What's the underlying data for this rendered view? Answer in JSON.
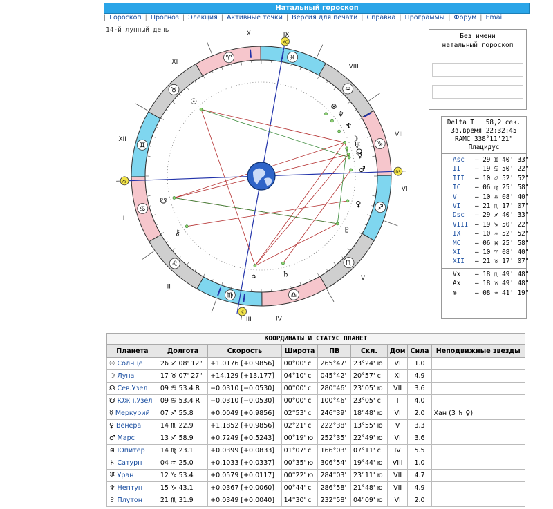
{
  "page": {
    "title": "Натальный гороскоп",
    "lunar_day": "14-й лунный день"
  },
  "menu": [
    "Гороскоп",
    "Прогноз",
    "Элекция",
    "Активные точки",
    "Версия для печати",
    "Справка",
    "Программы",
    "Форум",
    "Email"
  ],
  "wheel": {
    "house_numerals": [
      "I",
      "II",
      "III",
      "IV",
      "V",
      "VI",
      "VII",
      "VIII",
      "IX",
      "X",
      "XI",
      "XII"
    ],
    "sign_glyphs": [
      "♊",
      "♋",
      "♌",
      "♍",
      "♎",
      "♏",
      "♐",
      "♑",
      "♒",
      "♓",
      "♈",
      "♉"
    ],
    "badges": [
      "AS",
      "DS",
      "MC",
      "IC"
    ],
    "planet_glyphs": [
      "☉",
      "☽",
      "☊",
      "☋",
      "☿",
      "♀",
      "♂",
      "♃",
      "♄",
      "♅",
      "♆",
      "♇",
      "⊗",
      "⚷",
      "♆"
    ],
    "center": "globe"
  },
  "info": {
    "name": "Без имени",
    "subtitle": "натальный гороскоп"
  },
  "positions": {
    "delta_t_label": "Delta T",
    "delta_t": "58,2 сек.",
    "star_time_label": "Зв.время",
    "star_time": "22:32:45",
    "ramc": "RAMC 338°11'21\"",
    "system": "Плацидус",
    "cusps": [
      {
        "name": "Asc",
        "value": "29 ♊ 40' 33\""
      },
      {
        "name": "II",
        "value": "19 ♋ 50' 22\""
      },
      {
        "name": "III",
        "value": "10 ♌ 52' 52\""
      },
      {
        "name": "IC",
        "value": "06 ♍ 25' 58\""
      },
      {
        "name": "V",
        "value": "10 ♎ 08' 40\""
      },
      {
        "name": "VI",
        "value": "21 ♏ 17' 07\""
      },
      {
        "name": "Dsc",
        "value": "29 ♐ 40' 33\""
      },
      {
        "name": "VIII",
        "value": "19 ♑ 50' 22\""
      },
      {
        "name": "IX",
        "value": "10 ♒ 52' 52\""
      },
      {
        "name": "MC",
        "value": "06 ♓ 25' 58\""
      },
      {
        "name": "XI",
        "value": "10 ♈ 08' 40\""
      },
      {
        "name": "XII",
        "value": "21 ♉ 17' 07\""
      }
    ],
    "points": [
      {
        "name": "Vx",
        "value": "18 ♏ 49' 48\""
      },
      {
        "name": "Ax",
        "value": "18 ♉ 49' 48\""
      },
      {
        "name": "⊗",
        "value": "08 ♒ 41' 19\""
      }
    ]
  },
  "table": {
    "title": "КООРДИНАТЫ И СТАТУС ПЛАНЕТ",
    "headers": [
      "Планета",
      "Долгота",
      "Скорость",
      "Широта",
      "ПВ",
      "Скл.",
      "Дом",
      "Сила",
      "Неподвижные звезды"
    ],
    "rows": [
      {
        "glyph": "☉",
        "name": "Солнце",
        "lon": "26 ♐ 08' 12\"",
        "speed": "+1.0176",
        "speed2": "[+0.9856]",
        "lat": "00°00' с",
        "ra": "265°47'",
        "dec": "23°24' ю",
        "house": "VI",
        "power": "1.0",
        "stars": ""
      },
      {
        "glyph": "☽",
        "name": "Луна",
        "lon": "17 ♉ 07' 27\"",
        "speed": "+14.129",
        "speed2": "[+13.177]",
        "lat": "04°10' с",
        "ra": "045°42'",
        "dec": "20°57' с",
        "house": "XI",
        "power": "4.9",
        "stars": ""
      },
      {
        "glyph": "☊",
        "name": "Сев.Узел",
        "lon": "09 ♋ 53.4 R",
        "speed": "−0.0310",
        "speed2": "[−0.0530]",
        "lat": "00°00' с",
        "ra": "280°46'",
        "dec": "23°05' ю",
        "house": "VII",
        "power": "3.6",
        "stars": ""
      },
      {
        "glyph": "☋",
        "name": "Южн.Узел",
        "lon": "09 ♋ 53.4 R",
        "speed": "−0.0310",
        "speed2": "[−0.0530]",
        "lat": "00°00' с",
        "ra": "100°46'",
        "dec": "23°05' с",
        "house": "I",
        "power": "4.0",
        "stars": ""
      },
      {
        "glyph": "☿",
        "name": "Меркурий",
        "lon": "07 ♐ 55.8",
        "speed": "+0.0049",
        "speed2": "[+0.9856]",
        "lat": "02°53' с",
        "ra": "246°39'",
        "dec": "18°48' ю",
        "house": "VI",
        "power": "2.0",
        "stars": "Хан (3 ♄ ♀)"
      },
      {
        "glyph": "♀",
        "name": "Венера",
        "lon": "14 ♏ 22.9",
        "speed": "+1.1852",
        "speed2": "[+0.9856]",
        "lat": "02°21' с",
        "ra": "222°38'",
        "dec": "13°55' ю",
        "house": "V",
        "power": "3.3",
        "stars": ""
      },
      {
        "glyph": "♂",
        "name": "Марс",
        "lon": "13 ♐ 58.9",
        "speed": "+0.7249",
        "speed2": "[+0.5243]",
        "lat": "00°19' ю",
        "ra": "252°35'",
        "dec": "22°49' ю",
        "house": "VI",
        "power": "3.6",
        "stars": ""
      },
      {
        "glyph": "♃",
        "name": "Юпитер",
        "lon": "14 ♍ 23.1",
        "speed": "+0.0399",
        "speed2": "[+0.0833]",
        "lat": "01°07' с",
        "ra": "166°03'",
        "dec": "07°11' с",
        "house": "IV",
        "power": "5.5",
        "stars": ""
      },
      {
        "glyph": "♄",
        "name": "Сатурн",
        "lon": "04 ♒ 25.0",
        "speed": "+0.1033",
        "speed2": "[+0.0337]",
        "lat": "00°35' ю",
        "ra": "306°54'",
        "dec": "19°44' ю",
        "house": "VIII",
        "power": "1.0",
        "stars": ""
      },
      {
        "glyph": "♅",
        "name": "Уран",
        "lon": "12 ♑ 53.4",
        "speed": "+0.0579",
        "speed2": "[+0.0117]",
        "lat": "00°22' ю",
        "ra": "284°03'",
        "dec": "23°11' ю",
        "house": "VII",
        "power": "4.7",
        "stars": ""
      },
      {
        "glyph": "♆",
        "name": "Нептун",
        "lon": "15 ♑ 43.1",
        "speed": "+0.0367",
        "speed2": "[+0.0060]",
        "lat": "00°44' с",
        "ra": "286°58'",
        "dec": "21°48' ю",
        "house": "VII",
        "power": "4.9",
        "stars": ""
      },
      {
        "glyph": "♇",
        "name": "Плутон",
        "lon": "21 ♏ 31.9",
        "speed": "+0.0349",
        "speed2": "[+0.0040]",
        "lat": "14°30' с",
        "ra": "232°58'",
        "dec": "04°09' ю",
        "house": "VI",
        "power": "2.0",
        "stars": ""
      }
    ]
  },
  "colors": {
    "header_blue": "#2aa5e8",
    "link_blue": "#1a4ea0",
    "cyan": "#7fd6ef",
    "pink": "#f6c6cc",
    "grey": "#cfcfcf",
    "aspect_red": "#b43030",
    "aspect_green": "#3a8a3a",
    "badge_yellow": "#f3e44a"
  }
}
